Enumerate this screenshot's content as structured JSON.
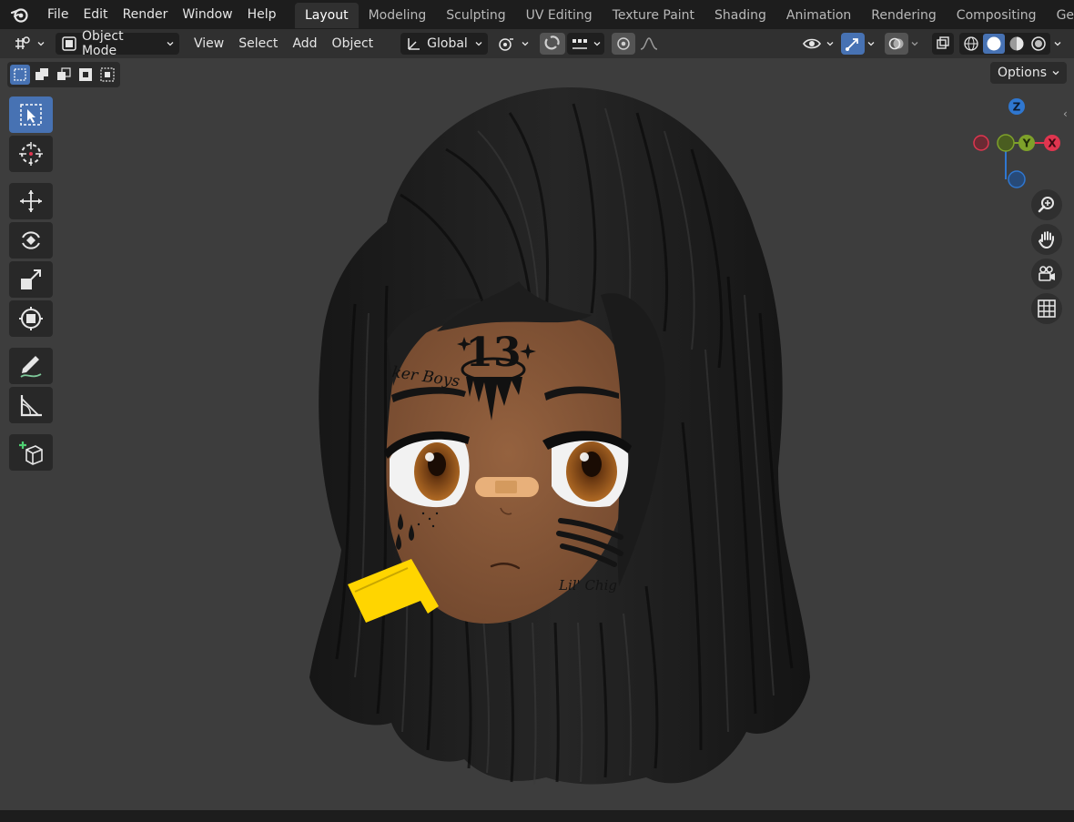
{
  "menu": {
    "items": [
      "File",
      "Edit",
      "Render",
      "Window",
      "Help"
    ]
  },
  "workspace_tabs": [
    "Layout",
    "Modeling",
    "Sculpting",
    "UV Editing",
    "Texture Paint",
    "Shading",
    "Animation",
    "Rendering",
    "Compositing",
    "Geom"
  ],
  "active_tab": "Layout",
  "header": {
    "mode_label": "Object Mode",
    "menus": [
      "View",
      "Select",
      "Add",
      "Object"
    ],
    "transform_orientation": "Global"
  },
  "viewport": {
    "options_label": "Options",
    "gizmo": {
      "x_label": "X",
      "y_label": "Y",
      "z_label": "Z"
    }
  },
  "tools": [
    "select-box",
    "cursor",
    "move",
    "rotate",
    "scale",
    "transform",
    "annotate",
    "measure",
    "add-cube"
  ],
  "scene": {
    "tattoo_number": "13",
    "tattoo_text": "ker Boys",
    "cheek_text": "Lil' Chig"
  },
  "colors": {
    "accent": "#4772b3",
    "viewport_bg": "#3d3d3d",
    "x_axis": "#e0354f",
    "y_axis": "#7ea12a",
    "z_axis": "#2f77d0",
    "skin": "#8a5a3c",
    "hair": "#1a1a1a",
    "hair_tie": "#ffd500"
  }
}
